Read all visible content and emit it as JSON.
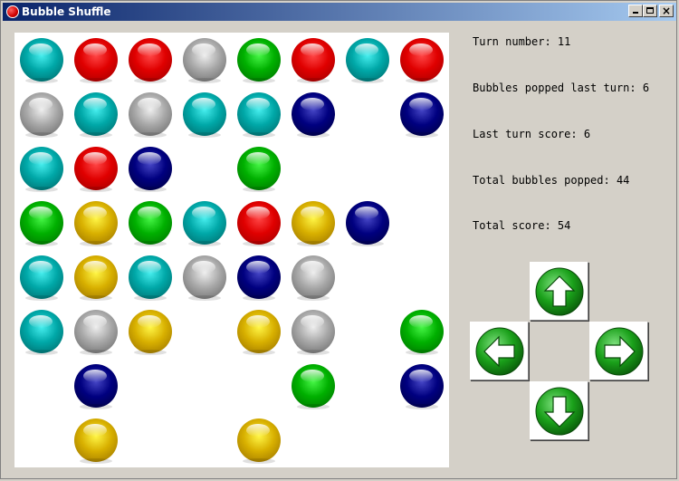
{
  "window": {
    "title": "Bubble Shuffle"
  },
  "colors": {
    "cyan": "#00a8a8",
    "red": "#e00000",
    "gray": "#a8a8a8",
    "green": "#00b000",
    "navy": "#000080",
    "yellow": "#d8b000"
  },
  "board": {
    "rows": 8,
    "cols": 8,
    "grid": [
      [
        "cyan",
        "red",
        "red",
        "gray",
        "green",
        "red",
        "cyan",
        "red"
      ],
      [
        "gray",
        "cyan",
        "gray",
        "cyan",
        "cyan",
        "navy",
        null,
        "navy"
      ],
      [
        "cyan",
        "red",
        "navy",
        null,
        "green",
        null,
        null,
        null
      ],
      [
        "green",
        "yellow",
        "green",
        "cyan",
        "red",
        "yellow",
        "navy",
        null
      ],
      [
        "cyan",
        "yellow",
        "cyan",
        "gray",
        "navy",
        "gray",
        null,
        null
      ],
      [
        "cyan",
        "gray",
        "yellow",
        null,
        "yellow",
        "gray",
        null,
        "green"
      ],
      [
        null,
        "navy",
        null,
        null,
        null,
        "green",
        null,
        "navy"
      ],
      [
        null,
        "yellow",
        null,
        null,
        "yellow",
        null,
        null,
        null
      ]
    ]
  },
  "stats": {
    "turn": "Turn number: 11",
    "popped_last": "Bubbles popped last turn: 6",
    "last_score": "Last turn score: 6",
    "total_popped": "Total bubbles popped: 44",
    "total_score": "Total score: 54"
  },
  "controls": {
    "up_icon": "arrow-up-icon",
    "left_icon": "arrow-left-icon",
    "right_icon": "arrow-right-icon",
    "down_icon": "arrow-down-icon"
  }
}
